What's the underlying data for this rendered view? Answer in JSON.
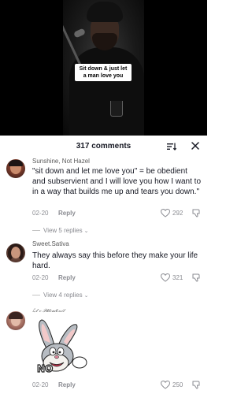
{
  "video": {
    "caption": "Sit down & just let a man love you"
  },
  "comments_sheet": {
    "count_label": "317 comments",
    "sort_icon": "sort-icon",
    "close_icon": "close-icon"
  },
  "comments": [
    {
      "username": "Sunshine, Not Hazel",
      "text": "\"sit down and let me love you\" = be obedient and subservient and I will love you how I want to in a way that builds me up and tears you down.\"",
      "date": "02-20",
      "reply_label": "Reply",
      "likes": "292",
      "view_replies": "View 5 replies"
    },
    {
      "username": "Sweet.Sativa",
      "text": "They always say this before they make your life hard.",
      "date": "02-20",
      "reply_label": "Reply",
      "likes": "321",
      "view_replies": "View 4 replies"
    },
    {
      "username": "ℒ𝓁 𝓋 𝒫𝒽𝑜𝓂𝑒𝓃𝒾𝓉",
      "sticker_text": "NO",
      "sticker_icon": "bugs-bunny-no-sticker",
      "date": "02-20",
      "reply_label": "Reply",
      "likes": "250"
    }
  ]
}
